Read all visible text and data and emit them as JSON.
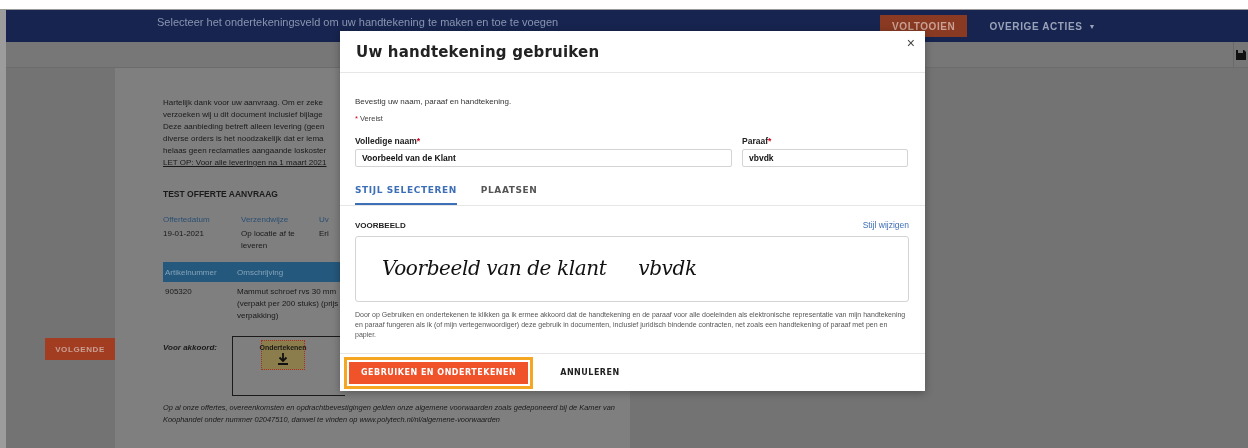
{
  "top_bar": {
    "message": "Selecteer het ondertekeningsveld om uw handtekening te maken en toe te voegen",
    "finish_button": "VOLTOOIEN",
    "more_actions": "OVERIGE ACTIES",
    "more_actions_caret": "▼"
  },
  "side": {
    "next_button": "VOLGENDE"
  },
  "document": {
    "intro_lines": [
      "Hartelijk dank voor uw aanvraag. Om er zeke",
      "verzoeken wij u dit document inclusief bijlage",
      "Deze aanbieding betreft alleen levering (geen",
      "diverse orders is het noodzakelijk dat er iema",
      "helaas geen reclamaties aangaande loskoster"
    ],
    "notice": "LET OP: Voor alle leveringen na 1 maart 2021",
    "heading": "TEST OFFERTE AANVRAAG",
    "info_columns": [
      {
        "label": "Offertedatum",
        "value_lines": [
          "19-01-2021"
        ]
      },
      {
        "label": "Verzendwijze",
        "value_lines": [
          "Op locatie af te",
          "leveren"
        ]
      },
      {
        "label": "Uv",
        "value_lines": [
          "Eri"
        ]
      }
    ],
    "table": {
      "columns": [
        "Artikelnummer",
        "Omschrijving"
      ],
      "rows": [
        {
          "cells": [
            [
              "905320"
            ],
            [
              "Mammut schroef rvs 30 mm",
              "(verpakt per 200 stuks) (prijs",
              "verpakking)"
            ]
          ]
        }
      ]
    },
    "approval_label": "Voor akkoord:",
    "sign_field": "Ondertekenen",
    "footer": "Op al onze offertes, overeenkomsten en opdrachtbevestigingen gelden onze algemene voorwaarden zoals gedeponeerd bij de Kamer van Koophandel onder nummer 02047510, danwel te vinden op www.polytech.nl/nl/algemene-voorwaarden"
  },
  "dialog": {
    "title": "Uw handtekening gebruiken",
    "close": "×",
    "instruction": "Bevestig uw naam, paraaf en handtekening.",
    "required_mark": "*",
    "required_note": "Vereist",
    "fields": [
      {
        "label": "Volledige naam",
        "required": true,
        "value": "Voorbeeld van de Klant"
      },
      {
        "label": "Paraaf",
        "required": true,
        "value": "vbvdk"
      }
    ],
    "tabs": [
      {
        "label": "STIJL SELECTEREN",
        "selected": true
      },
      {
        "label": "PLAATSEN",
        "selected": false
      }
    ],
    "preview_label": "VOORBEELD",
    "change_style": "Stijl wijzigen",
    "signature": {
      "name": "Voorbeeld van de klant",
      "initials": "vbvdk"
    },
    "disclaimer": "Door op Gebruiken en ondertekenen te klikken ga ik ermee akkoord dat de handtekening en de paraaf voor alle doeleinden als elektronische representatie van mijn handtekening en paraaf fungeren als ik (of mijn vertegenwoordiger) deze gebruik in documenten, inclusief juridisch bindende contracten, net zoals een handtekening of paraaf met pen en papier.",
    "buttons": [
      {
        "label": "GEBRUIKEN EN ONDERTEKENEN",
        "kind": "primary",
        "focused": true
      },
      {
        "label": "ANNULEREN",
        "kind": "secondary",
        "focused": false
      }
    ]
  }
}
